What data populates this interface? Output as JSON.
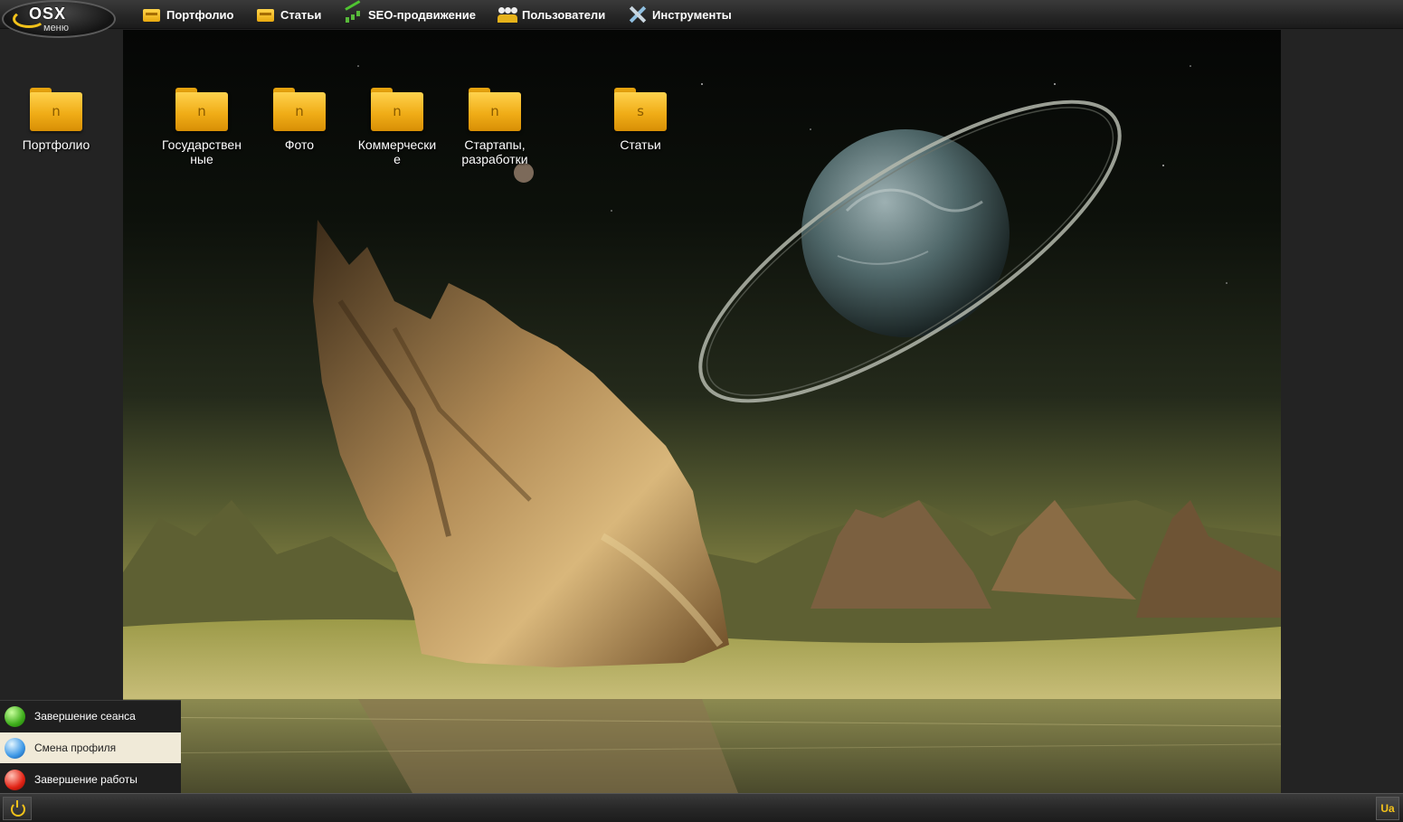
{
  "logo": {
    "mark": "OSX",
    "sub": "меню"
  },
  "topmenu": [
    {
      "label": "Портфолио",
      "icon": "folder-icon"
    },
    {
      "label": "Статьи",
      "icon": "folder-icon"
    },
    {
      "label": "SEO-продвижение",
      "icon": "chart-icon"
    },
    {
      "label": "Пользователи",
      "icon": "users-icon"
    },
    {
      "label": "Инструменты",
      "icon": "tools-icon"
    }
  ],
  "desktop": {
    "icons": [
      {
        "label": "Портфолио",
        "letter": "n"
      },
      {
        "label": "Государственные",
        "letter": "n"
      },
      {
        "label": "Фото",
        "letter": "n"
      },
      {
        "label": "Коммерческие",
        "letter": "n"
      },
      {
        "label": "Стартапы, разработки",
        "letter": "n"
      },
      {
        "label": "Статьи",
        "letter": "s"
      }
    ]
  },
  "start_menu": {
    "items": [
      {
        "label": "Завершение сеанса",
        "icon": "logout-icon",
        "color": "#3fae1c"
      },
      {
        "label": "Смена профиля",
        "icon": "switch-profile-icon",
        "color": "#3d98e6",
        "active": true
      },
      {
        "label": "Завершение работы",
        "icon": "shutdown-icon",
        "color": "#e22315"
      }
    ]
  },
  "taskbar": {
    "start_icon": "power-icon",
    "language": "Ua"
  },
  "colors": {
    "accent": "#f4c21a",
    "menu_bg": "#262626",
    "desktop_bg": "#232323"
  }
}
